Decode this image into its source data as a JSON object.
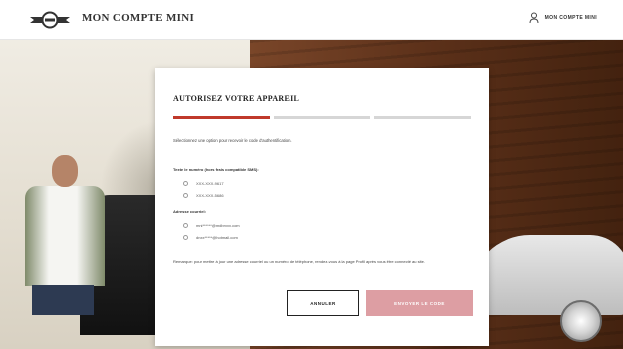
{
  "header": {
    "title": "MON COMPTE MINI",
    "account_label": "MON COMPTE MINI"
  },
  "modal": {
    "title": "AUTORISEZ VOTRE APPAREIL",
    "intro": "Sélectionnez une option pour recevoir le code d'authentification.",
    "steps_total": 3,
    "steps_active": 1,
    "phone_section_label": "Texte le numéro (hors frais compatible SMS):",
    "phone_options": [
      "XXX-XXX-9617",
      "XXX-XXX-5686"
    ],
    "email_section_label": "Adresse courriel:",
    "email_options": [
      "mni******@mdbrxxx.com",
      "dnxx*****@hotmail.com"
    ],
    "note": "Remarque: pour mettre à jour une adresse courriel ou un numéro de téléphone, rendez-vous à la page Profil après vous être connecté au site.",
    "cancel_label": "ANNULER",
    "send_label": "ENVOYER LE CODE"
  },
  "colors": {
    "accent_red": "#c0392b",
    "send_button": "#dd9ea3"
  }
}
